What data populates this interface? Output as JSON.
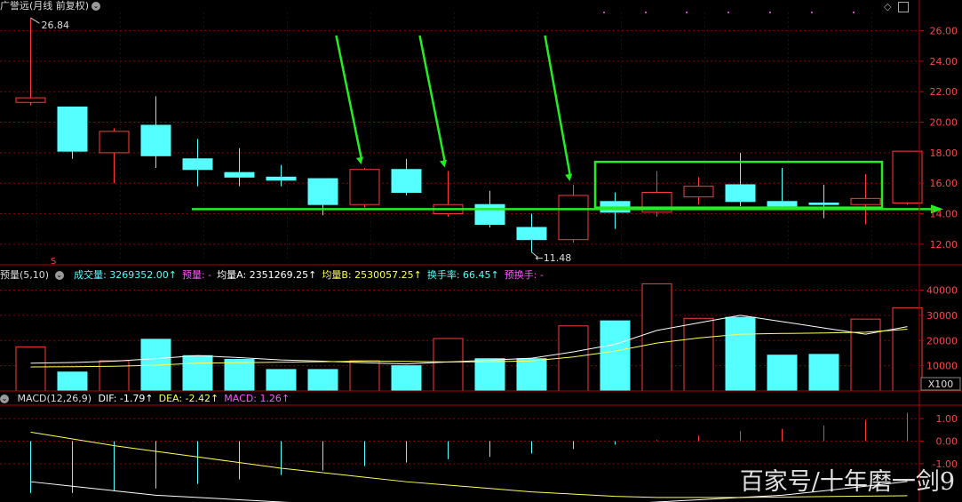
{
  "main_panel": {
    "title": "广誉远(月线 前复权)",
    "high_label": "26.84",
    "low_label": "11.48",
    "s_marker": "S",
    "corner_icons": [
      "diamond-icon",
      "settings-icon"
    ]
  },
  "volume_panel": {
    "title": "预量(5,10)",
    "fields": [
      {
        "label": "成交量: 3269352.00",
        "color": "#55ffff"
      },
      {
        "label": "预量: -",
        "color": "#ff55ff"
      },
      {
        "label": "均量A: 2351269.25",
        "color": "#ffffff"
      },
      {
        "label": "均量B: 2530057.25",
        "color": "#ffff55"
      },
      {
        "label": "换手率: 66.45",
        "color": "#55ffff"
      },
      {
        "label": "预换手: -",
        "color": "#ff55ff"
      }
    ],
    "unit_label": "X100"
  },
  "macd_panel": {
    "title": "MACD(12,26,9)",
    "fields": [
      {
        "label": "DIF: -1.79",
        "color": "#ffffff"
      },
      {
        "label": "DEA: -2.42",
        "color": "#ffff55"
      },
      {
        "label": "MACD: 1.26",
        "color": "#ff55ff"
      }
    ]
  },
  "watermark": "百家号/十年磨一剑9",
  "colors": {
    "up": "#ff3a3a",
    "down": "#55ffff",
    "grid": "#8b0000",
    "annotation": "#22ee22",
    "axis_text": "#ff4444"
  },
  "chart_data": [
    {
      "type": "candlestick",
      "title": "广誉远(月线 前复权)",
      "y_ticks": [
        12.0,
        14.0,
        16.0,
        18.0,
        20.0,
        22.0,
        24.0,
        26.0
      ],
      "ylim": [
        11.0,
        27.2
      ],
      "grid": true,
      "candles": [
        {
          "o": 21.3,
          "c": 21.6,
          "h": 26.84,
          "l": 21.1
        },
        {
          "o": 21.0,
          "c": 18.1,
          "h": 21.0,
          "l": 17.6
        },
        {
          "o": 18.0,
          "c": 19.4,
          "h": 19.6,
          "l": 16.0
        },
        {
          "o": 19.8,
          "c": 17.8,
          "h": 21.7,
          "l": 17.0
        },
        {
          "o": 17.6,
          "c": 16.9,
          "h": 18.9,
          "l": 15.8
        },
        {
          "o": 16.7,
          "c": 16.4,
          "h": 18.3,
          "l": 15.8
        },
        {
          "o": 16.4,
          "c": 16.2,
          "h": 17.2,
          "l": 15.8
        },
        {
          "o": 16.3,
          "c": 14.6,
          "h": 16.3,
          "l": 13.9
        },
        {
          "o": 14.6,
          "c": 16.9,
          "h": 17.0,
          "l": 14.4
        },
        {
          "o": 16.9,
          "c": 15.4,
          "h": 17.6,
          "l": 15.2
        },
        {
          "o": 14.0,
          "c": 14.6,
          "h": 16.8,
          "l": 13.8
        },
        {
          "o": 14.6,
          "c": 13.3,
          "h": 15.5,
          "l": 13.1
        },
        {
          "o": 13.1,
          "c": 12.3,
          "h": 14.0,
          "l": 11.48
        },
        {
          "o": 12.3,
          "c": 15.2,
          "h": 15.9,
          "l": 12.1
        },
        {
          "o": 14.8,
          "c": 14.1,
          "h": 15.4,
          "l": 13.0
        },
        {
          "o": 14.1,
          "c": 15.4,
          "h": 16.8,
          "l": 13.8
        },
        {
          "o": 15.1,
          "c": 15.8,
          "h": 16.4,
          "l": 14.6
        },
        {
          "o": 15.9,
          "c": 14.8,
          "h": 18.0,
          "l": 14.5
        },
        {
          "o": 14.8,
          "c": 14.5,
          "h": 17.0,
          "l": 14.3
        },
        {
          "o": 14.7,
          "c": 14.6,
          "h": 15.9,
          "l": 13.7
        },
        {
          "o": 14.6,
          "c": 15.0,
          "h": 16.6,
          "l": 13.3
        },
        {
          "o": 14.7,
          "c": 18.1,
          "h": 18.1,
          "l": 14.6
        }
      ],
      "annotations": {
        "support_line_price": 14.3,
        "box": {
          "from_index": 14,
          "to_index": 20,
          "y_top": 17.4,
          "y_bottom": 14.4
        },
        "arrows_down_to_index": [
          8,
          10,
          13
        ]
      }
    },
    {
      "type": "bar",
      "title": "预量(5,10)",
      "y_ticks": [
        10000,
        20000,
        30000,
        40000
      ],
      "ylim": [
        0,
        43000
      ],
      "volumes": [
        17500,
        7500,
        12000,
        20500,
        14000,
        12500,
        8500,
        8500,
        12000,
        10000,
        20800,
        12800,
        12800,
        25800,
        27800,
        42500,
        28800,
        29200,
        14200,
        14500,
        28500,
        33000
      ],
      "series": [
        {
          "name": "均量A",
          "values": [
            11000,
            11300,
            11800,
            12800,
            14000,
            13200,
            12300,
            11800,
            11200,
            10700,
            11500,
            12200,
            13000,
            15500,
            18500,
            24000,
            27000,
            30000,
            27500,
            25000,
            22500,
            25500
          ]
        },
        {
          "name": "均量B",
          "values": [
            9500,
            9600,
            9800,
            10200,
            11000,
            11200,
            11400,
            11600,
            11800,
            11700,
            11500,
            11600,
            11900,
            13500,
            15800,
            19000,
            21000,
            22500,
            22800,
            23000,
            23300,
            24500
          ]
        }
      ]
    },
    {
      "type": "bar",
      "title": "MACD(12,26,9)",
      "y_ticks": [
        -1.0,
        0.0,
        1.0
      ],
      "ylim": [
        -2.7,
        1.6
      ],
      "macd": [
        -2.3,
        -2.3,
        -2.2,
        -2.1,
        -1.9,
        -1.7,
        -1.5,
        -1.3,
        -1.1,
        -0.95,
        -0.8,
        -0.7,
        -0.55,
        -0.35,
        -0.15,
        0.05,
        0.25,
        0.45,
        0.55,
        0.7,
        0.95,
        1.26
      ],
      "series": [
        {
          "name": "DIF",
          "values": [
            -1.8,
            -2.0,
            -2.2,
            -2.4,
            -2.5,
            -2.6,
            -2.7,
            -2.8,
            -2.9,
            -3.0,
            -3.0,
            -3.0,
            -3.0,
            -2.9,
            -2.8,
            -2.7,
            -2.6,
            -2.5,
            -2.4,
            -2.2,
            -2.0,
            -1.79
          ]
        },
        {
          "name": "DEA",
          "values": [
            0.4,
            0.1,
            -0.2,
            -0.45,
            -0.7,
            -0.95,
            -1.2,
            -1.4,
            -1.6,
            -1.8,
            -1.95,
            -2.1,
            -2.25,
            -2.35,
            -2.45,
            -2.5,
            -2.5,
            -2.5,
            -2.48,
            -2.46,
            -2.44,
            -2.42
          ]
        }
      ]
    }
  ]
}
